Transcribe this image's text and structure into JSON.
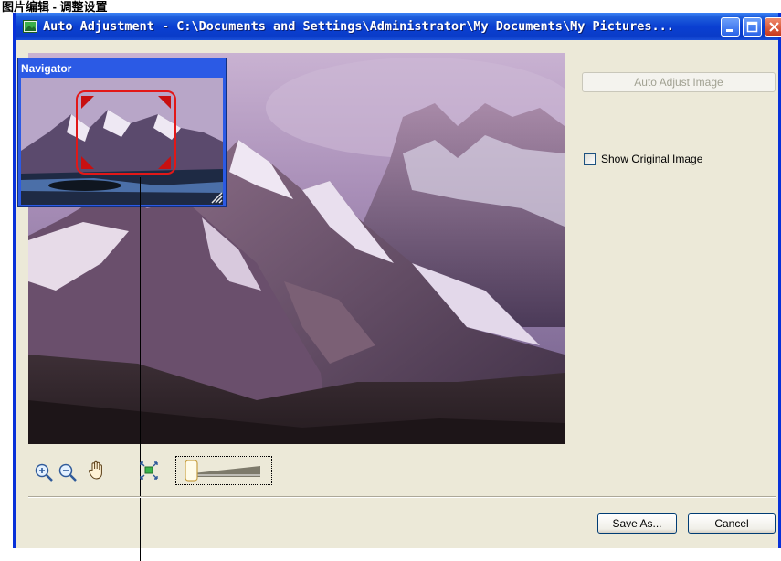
{
  "heading": "图片编辑 - 调整设置",
  "window": {
    "title": "Auto Adjustment - C:\\Documents and Settings\\Administrator\\My Documents\\My Pictures..."
  },
  "navigator": {
    "title": "Navigator"
  },
  "buttons": {
    "auto_adjust": "Auto Adjust Image",
    "save_as": "Save As...",
    "cancel": "Cancel"
  },
  "show_original": {
    "label": "Show Original Image",
    "checked": false
  },
  "toolbar": {
    "zoom_in": "zoom-in-icon",
    "zoom_out": "zoom-out-icon",
    "pan": "hand-pan-icon",
    "fit": "fit-to-window-icon"
  },
  "zoom_slider": {
    "level": 0
  },
  "colors": {
    "titlebar": "#0a3fd2",
    "face": "#ece9d8",
    "navigator": "#2b5ae5",
    "viewport": "#e21818"
  }
}
